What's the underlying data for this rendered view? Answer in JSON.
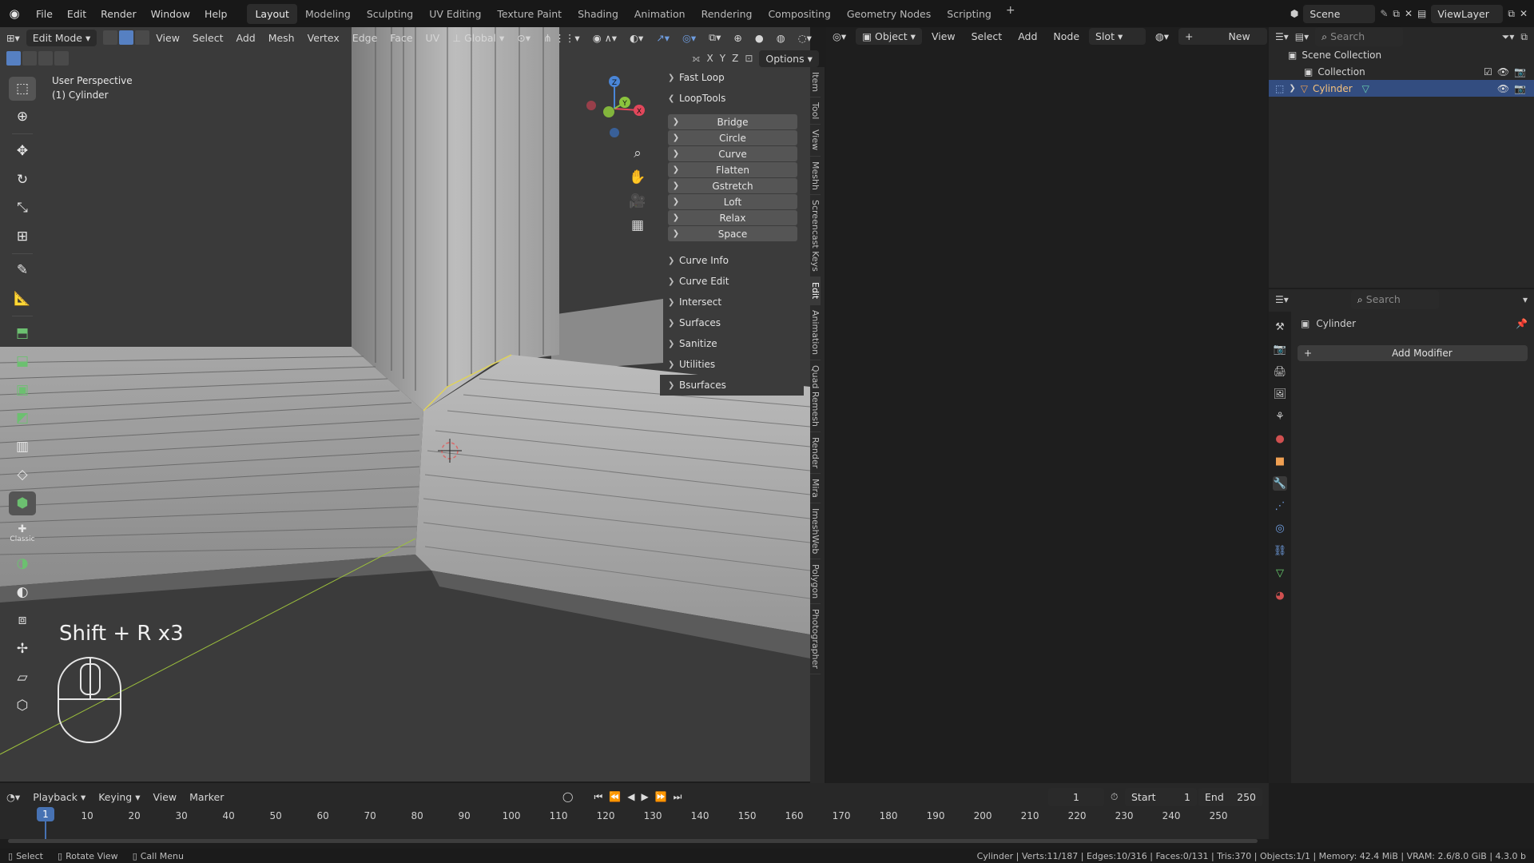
{
  "menubar": {
    "items": [
      "File",
      "Edit",
      "Render",
      "Window",
      "Help"
    ],
    "workspaces": [
      "Layout",
      "Modeling",
      "Sculpting",
      "UV Editing",
      "Texture Paint",
      "Shading",
      "Animation",
      "Rendering",
      "Compositing",
      "Geometry Nodes",
      "Scripting"
    ],
    "active_workspace": "Layout",
    "scene": "Scene",
    "view_layer": "ViewLayer"
  },
  "viewport": {
    "mode": "Edit Mode",
    "menus": [
      "View",
      "Select",
      "Add",
      "Mesh",
      "Vertex",
      "Edge",
      "Face",
      "UV"
    ],
    "transform_orientation": "Global",
    "axes": [
      "X",
      "Y",
      "Z"
    ],
    "options_label": "Options",
    "perspective_label": "User Perspective",
    "object_label": "(1) Cylinder",
    "classic_label": "Classic",
    "gizmo_axes": [
      "Z",
      "Y",
      "X"
    ],
    "shortcut_text": "Shift + R x3"
  },
  "npanel": {
    "fast_loop": "Fast Loop",
    "looptools": "LoopTools",
    "looptools_buttons": [
      "Bridge",
      "Circle",
      "Curve",
      "Flatten",
      "Gstretch",
      "Loft",
      "Relax",
      "Space"
    ],
    "sections": [
      "Curve Info",
      "Curve Edit",
      "Intersect",
      "Surfaces",
      "Sanitize",
      "Utilities",
      "Bsurfaces"
    ],
    "tabs": [
      "Item",
      "Tool",
      "View",
      "Meshh",
      "Screencast Keys",
      "Edit",
      "Animation",
      "Quad Remesh",
      "Render",
      "Mira",
      "ImeshWeb",
      "Polygon",
      "Photographer"
    ]
  },
  "node_editor": {
    "type": "Object",
    "menus": [
      "View",
      "Select",
      "Add",
      "Node"
    ],
    "slot": "Slot",
    "new_label": "New"
  },
  "outliner": {
    "search_placeholder": "Search",
    "scene_collection": "Scene Collection",
    "collection": "Collection",
    "object": "Cylinder"
  },
  "properties": {
    "search_placeholder": "Search",
    "object_name": "Cylinder",
    "add_modifier": "Add Modifier"
  },
  "timeline": {
    "menus": [
      "Playback",
      "Keying",
      "View",
      "Marker"
    ],
    "current_frame": "1",
    "start_label": "Start",
    "start": "1",
    "end_label": "End",
    "end": "250",
    "ticks": [
      "10",
      "20",
      "30",
      "40",
      "50",
      "60",
      "70",
      "80",
      "90",
      "100",
      "110",
      "120",
      "130",
      "140",
      "150",
      "160",
      "170",
      "180",
      "190",
      "200",
      "210",
      "220",
      "230",
      "240",
      "250"
    ],
    "cursor_frame": "1"
  },
  "statusbar": {
    "select": "Select",
    "rotate": "Rotate View",
    "call_menu": "Call Menu",
    "stats": "Cylinder | Verts:11/187 | Edges:10/316 | Faces:0/131 | Tris:370 | Objects:1/1 | Memory: 42.4 MiB | VRAM: 2.6/8.0 GiB | 4.3.0 b"
  }
}
